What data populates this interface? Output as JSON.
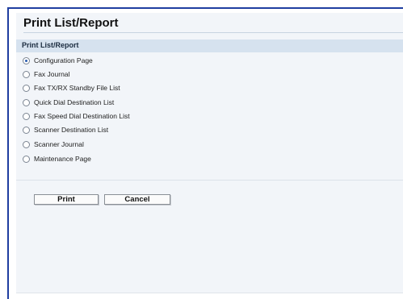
{
  "page": {
    "title": "Print List/Report"
  },
  "section": {
    "header": "Print List/Report"
  },
  "options": [
    {
      "label": "Configuration Page",
      "selected": true
    },
    {
      "label": "Fax Journal",
      "selected": false
    },
    {
      "label": "Fax TX/RX Standby File List",
      "selected": false
    },
    {
      "label": "Quick Dial Destination List",
      "selected": false
    },
    {
      "label": "Fax Speed Dial Destination List",
      "selected": false
    },
    {
      "label": "Scanner Destination List",
      "selected": false
    },
    {
      "label": "Scanner Journal",
      "selected": false
    },
    {
      "label": "Maintenance Page",
      "selected": false
    }
  ],
  "buttons": {
    "print": "Print",
    "cancel": "Cancel"
  },
  "colors": {
    "frame": "#1f3ea0",
    "panel": "#f2f5f9",
    "section_header": "#d6e2ef",
    "radio_dot": "#2a5db0"
  }
}
